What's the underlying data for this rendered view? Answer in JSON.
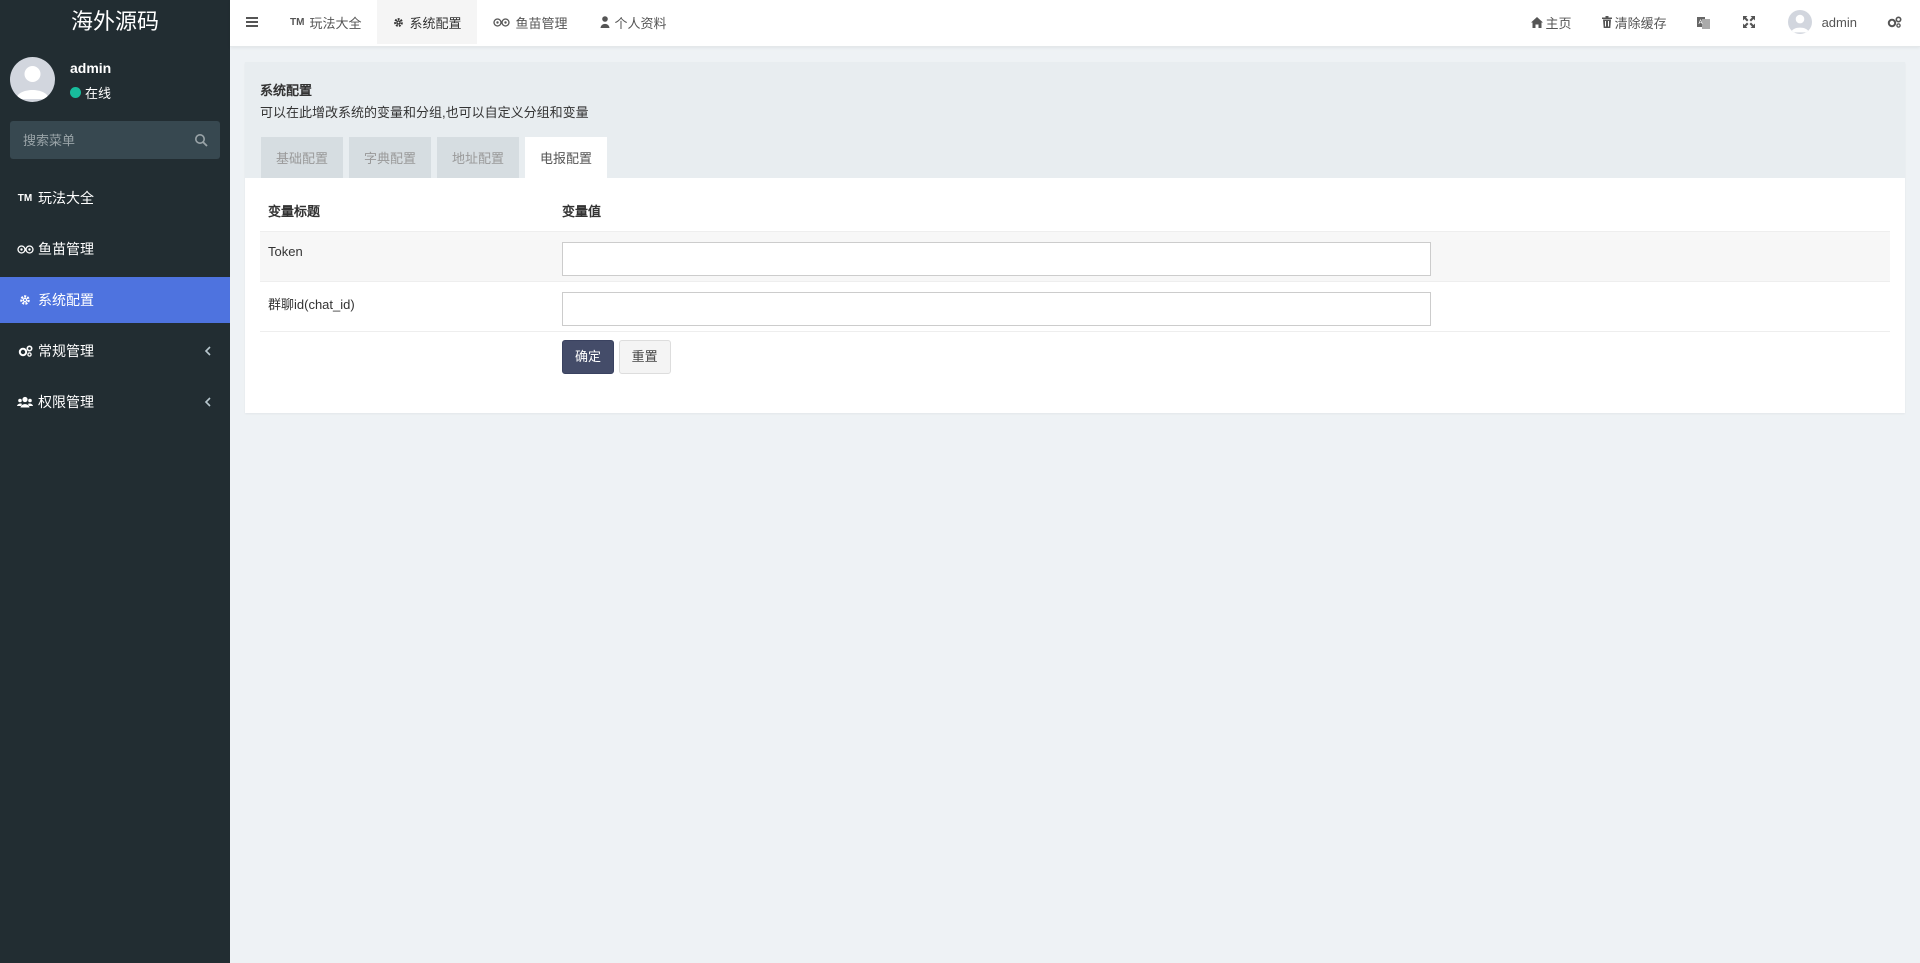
{
  "brand": "海外源码",
  "user": {
    "name": "admin",
    "status": "在线"
  },
  "search": {
    "placeholder": "搜索菜单"
  },
  "sidebar": {
    "items": [
      {
        "label": "玩法大全",
        "icon": "trademark-icon"
      },
      {
        "label": "鱼苗管理",
        "icon": "tripadvisor-icon"
      },
      {
        "label": "系统配置",
        "icon": "gear-icon",
        "active": true
      },
      {
        "label": "常规管理",
        "icon": "cogs-icon"
      },
      {
        "label": "权限管理",
        "icon": "users-icon"
      }
    ]
  },
  "topnav": {
    "tabs": [
      {
        "label": "玩法大全"
      },
      {
        "label": "系统配置",
        "active": true
      },
      {
        "label": "鱼苗管理"
      },
      {
        "label": "个人资料"
      }
    ],
    "right": {
      "home": "主页",
      "clear_cache": "清除缓存",
      "user": "admin"
    }
  },
  "panel": {
    "title": "系统配置",
    "description": "可以在此增改系统的变量和分组,也可以自定义分组和变量",
    "tabs": [
      "基础配置",
      "字典配置",
      "地址配置",
      "电报配置"
    ],
    "active_tab": "电报配置",
    "table": {
      "headers": [
        "变量标题",
        "变量值"
      ],
      "rows": [
        {
          "label": "Token",
          "value": ""
        },
        {
          "label": "群聊id(chat_id)",
          "value": ""
        }
      ]
    },
    "buttons": {
      "submit": "确定",
      "reset": "重置"
    }
  },
  "colors": {
    "sidebar_bg": "#222d32",
    "accent": "#4e73df",
    "primary_button": "#444c69",
    "status_online": "#18bc9c"
  }
}
